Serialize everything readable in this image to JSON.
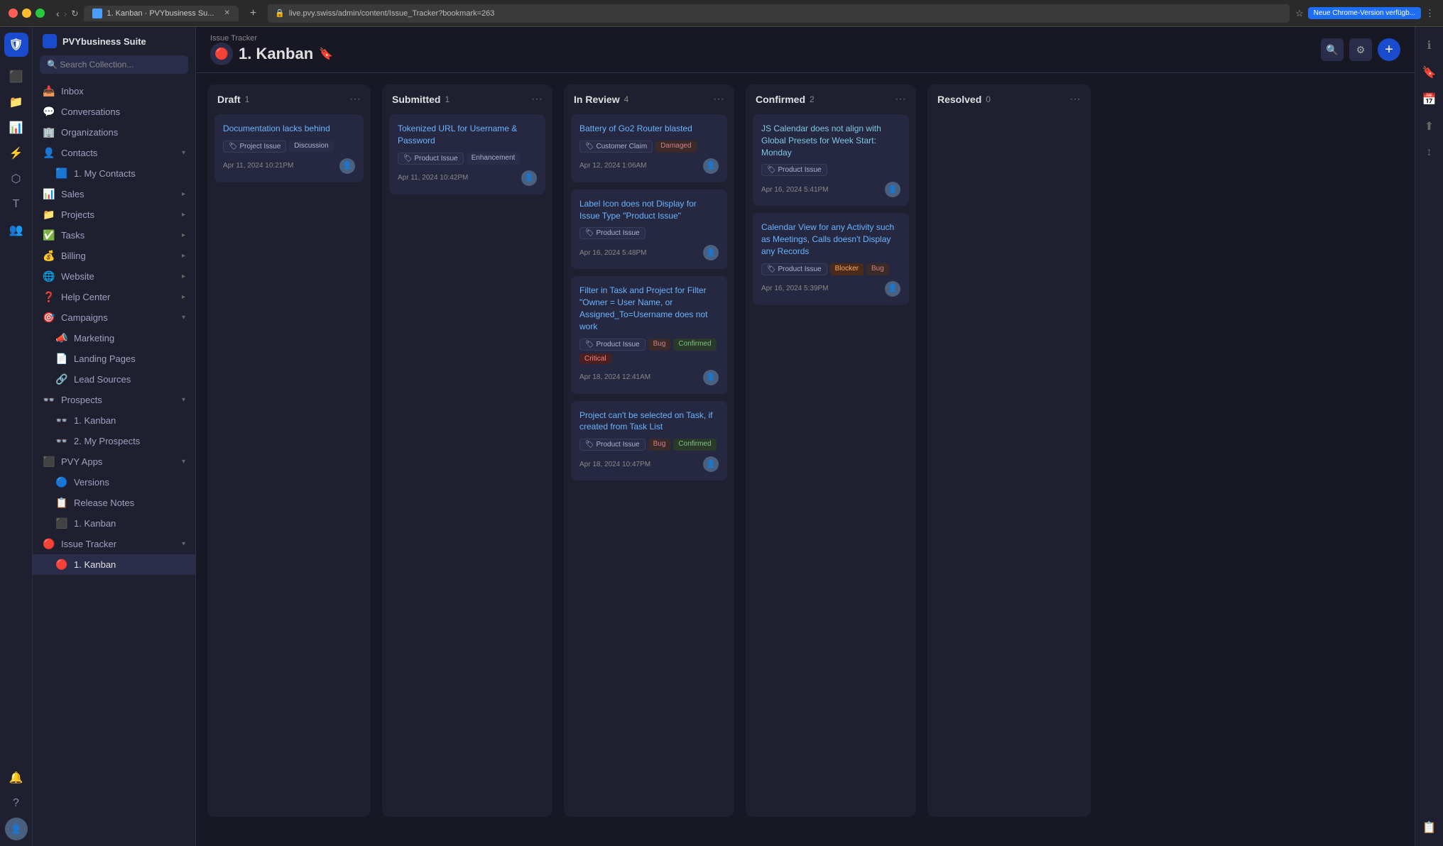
{
  "browser": {
    "tab_title": "1. Kanban · PVYbusiness Su...",
    "url": "live.pvy.swiss/admin/content/Issue_Tracker?bookmark=263",
    "new_tab": "+",
    "update_btn": "Neue Chrome-Version verfügb..."
  },
  "sidebar": {
    "app_name": "PVYbusiness Suite",
    "search_placeholder": "Search Collection...",
    "items": [
      {
        "id": "inbox",
        "label": "Inbox",
        "icon": "📥"
      },
      {
        "id": "conversations",
        "label": "Conversations",
        "icon": "💬"
      },
      {
        "id": "organizations",
        "label": "Organizations",
        "icon": "🏢"
      },
      {
        "id": "contacts",
        "label": "Contacts",
        "icon": "👤",
        "chevron": "▾"
      },
      {
        "id": "my-contacts",
        "label": "1. My Contacts",
        "icon": "",
        "sub": true
      },
      {
        "id": "sales",
        "label": "Sales",
        "icon": "📊",
        "chevron": "▸"
      },
      {
        "id": "projects",
        "label": "Projects",
        "icon": "📁",
        "chevron": "▸"
      },
      {
        "id": "tasks",
        "label": "Tasks",
        "icon": "✅",
        "chevron": "▸"
      },
      {
        "id": "billing",
        "label": "Billing",
        "icon": "💰",
        "chevron": "▸"
      },
      {
        "id": "website",
        "label": "Website",
        "icon": "🌐",
        "chevron": "▸"
      },
      {
        "id": "help-center",
        "label": "Help Center",
        "icon": "❓",
        "chevron": "▸"
      },
      {
        "id": "campaigns",
        "label": "Campaigns",
        "icon": "🎯",
        "chevron": "▾"
      },
      {
        "id": "marketing",
        "label": "Marketing",
        "icon": "📣",
        "sub": true
      },
      {
        "id": "landing-pages",
        "label": "Landing Pages",
        "icon": "📄",
        "sub": true
      },
      {
        "id": "lead-sources",
        "label": "Lead Sources",
        "icon": "🔗",
        "sub": true
      },
      {
        "id": "prospects",
        "label": "Prospects",
        "icon": "👓",
        "chevron": "▾"
      },
      {
        "id": "kanban-prospects",
        "label": "1. Kanban",
        "icon": "👓",
        "sub": true
      },
      {
        "id": "my-prospects",
        "label": "2. My Prospects",
        "icon": "👓",
        "sub": true
      },
      {
        "id": "pvy-apps",
        "label": "PVY Apps",
        "icon": "⬛",
        "chevron": "▾"
      },
      {
        "id": "versions",
        "label": "Versions",
        "icon": "🔵",
        "sub": true
      },
      {
        "id": "release-notes",
        "label": "Release Notes",
        "icon": "📋",
        "sub": true
      },
      {
        "id": "kanban-apps",
        "label": "1. Kanban",
        "icon": "⬛",
        "sub": true
      },
      {
        "id": "issue-tracker",
        "label": "Issue Tracker",
        "icon": "🔴",
        "chevron": "▾"
      },
      {
        "id": "kanban-issue",
        "label": "1. Kanban",
        "icon": "🔴",
        "sub": true,
        "active": true
      }
    ]
  },
  "page": {
    "breadcrumb": "Issue Tracker",
    "title": "1. Kanban",
    "bookmark_icon": "🔖"
  },
  "columns": [
    {
      "id": "draft",
      "title": "Draft",
      "count": 1,
      "cards": [
        {
          "id": "c1",
          "title": "Documentation lacks behind",
          "tags": [
            {
              "label": "🏷 Project Issue",
              "type": "project"
            },
            {
              "label": "Discussion",
              "type": "discussion"
            }
          ],
          "date": "Apr 11, 2024 10:21PM",
          "has_avatar": true
        }
      ]
    },
    {
      "id": "submitted",
      "title": "Submitted",
      "count": 1,
      "cards": [
        {
          "id": "c2",
          "title": "Tokenized URL for Username & Password",
          "tags": [
            {
              "label": "🏷 Product Issue",
              "type": "product"
            },
            {
              "label": "Enhancement",
              "type": "enhancement"
            }
          ],
          "date": "Apr 11, 2024 10:42PM",
          "has_avatar": true
        }
      ]
    },
    {
      "id": "in-review",
      "title": "In Review",
      "count": 4,
      "cards": [
        {
          "id": "c3",
          "title": "Battery of Go2 Router blasted",
          "tags": [
            {
              "label": "🏷 Customer Claim",
              "type": "project"
            },
            {
              "label": "Damaged",
              "type": "damaged"
            }
          ],
          "date": "Apr 12, 2024 1:06AM",
          "has_avatar": true
        },
        {
          "id": "c4",
          "title": "Label Icon does not Display for Issue Type \"Product Issue\"",
          "tags": [
            {
              "label": "🏷 Product Issue",
              "type": "product"
            }
          ],
          "date": "Apr 16, 2024 5:48PM",
          "has_avatar": true
        },
        {
          "id": "c5",
          "title": "Filter in Task and Project for Filter \"Owner = User Name, or Assigned_To=Username does not work",
          "tags": [
            {
              "label": "🏷 Product Issue",
              "type": "product"
            },
            {
              "label": "Bug",
              "type": "bug"
            },
            {
              "label": "Confirmed",
              "type": "confirmed"
            },
            {
              "label": "Critical",
              "type": "critical"
            }
          ],
          "date": "Apr 18, 2024 12:41AM",
          "has_avatar": true
        },
        {
          "id": "c6",
          "title": "Project can't be selected on Task, if created from Task List",
          "tags": [
            {
              "label": "🏷 Product Issue",
              "type": "product"
            },
            {
              "label": "Bug",
              "type": "bug"
            },
            {
              "label": "Confirmed",
              "type": "confirmed"
            }
          ],
          "date": "Apr 18, 2024 10:47PM",
          "has_avatar": true
        }
      ]
    },
    {
      "id": "confirmed",
      "title": "Confirmed",
      "count": 2,
      "cards": [
        {
          "id": "c7",
          "title": "JS Calendar does not align with Global Presets for Week Start: Monday",
          "tags": [
            {
              "label": "🏷 Product Issue",
              "type": "product"
            }
          ],
          "date": "Apr 16, 2024 5:41PM",
          "has_avatar": true
        },
        {
          "id": "c8",
          "title": "Calendar View for any Activity such as Meetings, Calls doesn't Display any Records",
          "tags": [
            {
              "label": "🏷 Product Issue",
              "type": "product"
            },
            {
              "label": "Blocker",
              "type": "blocker"
            },
            {
              "label": "Bug",
              "type": "bug"
            }
          ],
          "date": "Apr 16, 2024 5:39PM",
          "has_avatar": true
        }
      ]
    },
    {
      "id": "resolved",
      "title": "Resolved",
      "count": 0,
      "cards": []
    }
  ]
}
